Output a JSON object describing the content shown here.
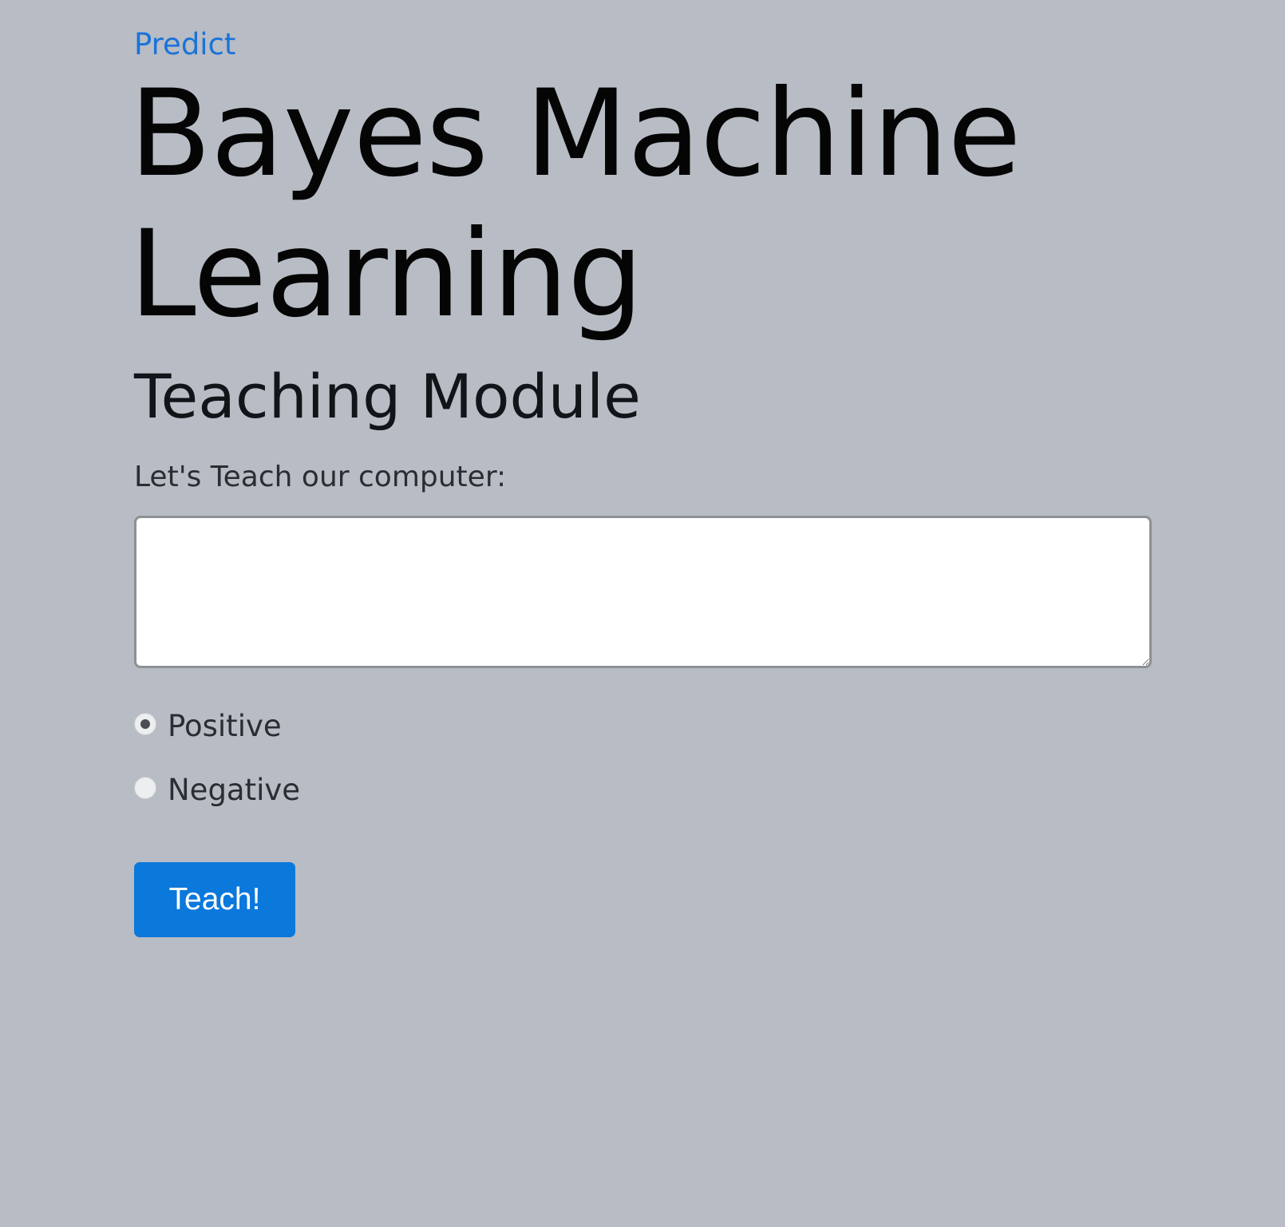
{
  "nav": {
    "predict_link": "Predict"
  },
  "header": {
    "title": "Bayes Machine Learning",
    "subtitle": "Teaching Module"
  },
  "form": {
    "prompt_label": "Let's Teach our computer:",
    "textarea_value": "",
    "sentiment_options": [
      {
        "label": "Positive",
        "selected": true
      },
      {
        "label": "Negative",
        "selected": false
      }
    ],
    "submit_label": "Teach!"
  },
  "colors": {
    "background": "#b8bcc4",
    "link": "#1a73d9",
    "button": "#0b78dc"
  }
}
